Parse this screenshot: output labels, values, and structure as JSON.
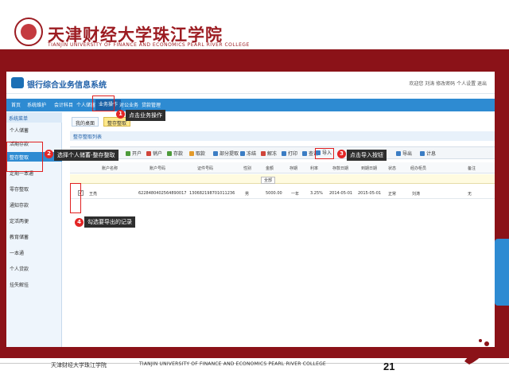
{
  "header": {
    "university_cn": "天津财经大学珠江学院",
    "university_en": "TIANJIN UNIVERSITY OF FINANCE AND ECONOMICS PEARL RIVER COLLEGE"
  },
  "app": {
    "title": "银行综合业务信息系统",
    "user_info": "欢迎您 刘涛  修改密码  个人设置  退出",
    "nav": [
      "首页",
      "系统维护",
      "会计科目",
      "个人储蓄",
      "业务操作",
      "对公业务",
      "贷款管理"
    ],
    "sidebar_title": "系统菜单",
    "sidebar": [
      "个人储蓄",
      "活期存款",
      "整存整取",
      "定期一本通",
      "零存整取",
      "通知存款",
      "定活两便",
      "教育储蓄",
      "一本通",
      "个人贷款",
      "挂失解挂"
    ],
    "tabs": [
      "我的桌面",
      "整存整取"
    ],
    "panel_title": "整存整取列表",
    "toolbar": [
      "开户",
      "销户",
      "存款",
      "取款",
      "部分提取",
      "冻结",
      "解冻",
      "打印",
      "查询",
      "导入",
      "导出",
      "计息"
    ],
    "table_headers": [
      "账户名称",
      "账户号码",
      "证件号码",
      "性别",
      "金额",
      "存期",
      "利率",
      "存款日期",
      "到期日期",
      "状态",
      "经办柜员",
      "备注"
    ],
    "filter_value": "全部",
    "row": [
      "王亮",
      "6228480402564890017",
      "130682198701011236",
      "男",
      "5000.00",
      "一年",
      "3.25%",
      "2014-05-01",
      "2015-05-01",
      "正常",
      "刘涛",
      "无"
    ]
  },
  "annotations": {
    "m1": "1",
    "m1_text": "点击业务操作",
    "m2": "2",
    "m2_text": "选择个人储蓄-整存整取",
    "m3": "3",
    "m3_text": "点击导入按钮",
    "m4": "4",
    "m4_text": "勾选要导出的记录"
  },
  "footer": {
    "cn": "天津财经大学珠江学院",
    "en": "TIANJIN UNIVERSITY OF FINANCE AND ECONOMICS PEARL RIVER COLLEGE",
    "page": "21"
  },
  "colors": {
    "band": "#8b1218",
    "nav": "#2e8bd2",
    "highlight": "#e02020"
  }
}
